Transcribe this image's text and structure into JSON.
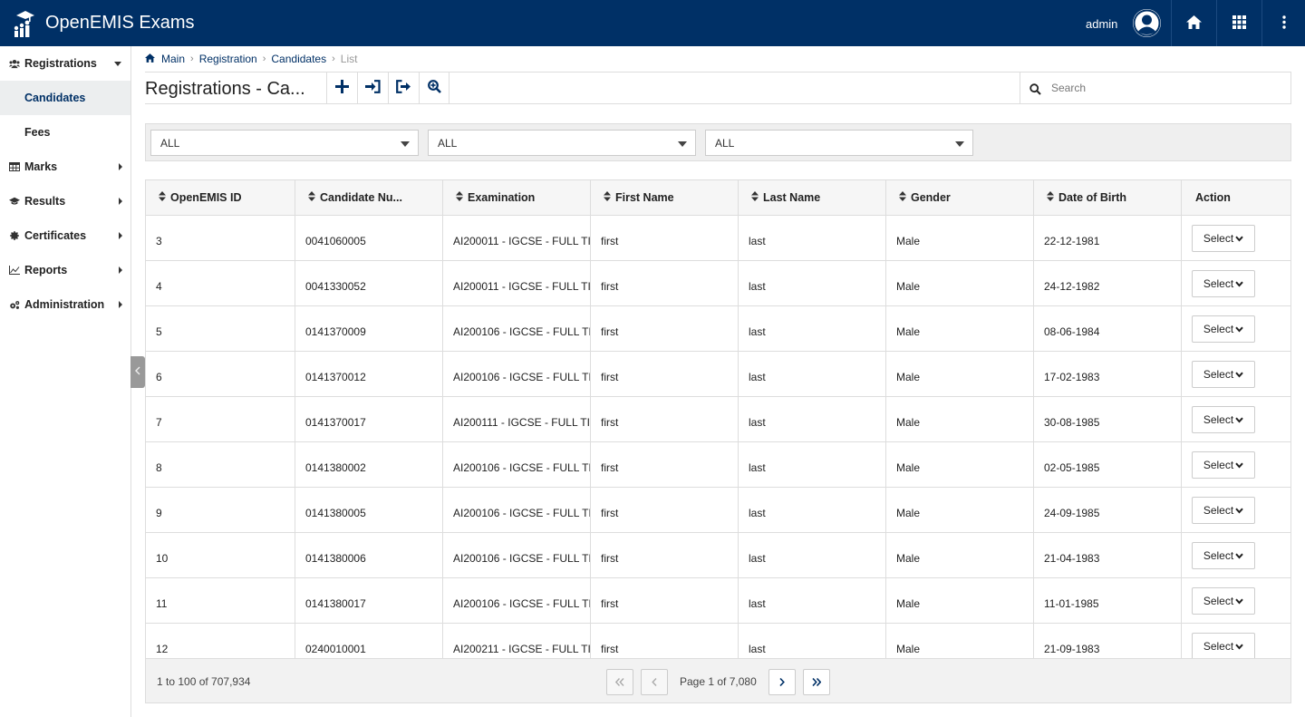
{
  "app": {
    "name": "OpenEMIS Exams",
    "user": "admin"
  },
  "sidebar": {
    "items": [
      {
        "label": "Registrations",
        "expanded": true,
        "icon": "users-icon"
      },
      {
        "label": "Marks",
        "icon": "table-icon"
      },
      {
        "label": "Results",
        "icon": "graduation-cap-icon"
      },
      {
        "label": "Certificates",
        "icon": "certificate-icon"
      },
      {
        "label": "Reports",
        "icon": "line-chart-icon"
      },
      {
        "label": "Administration",
        "icon": "cogs-icon"
      }
    ],
    "sub_items": [
      {
        "label": "Candidates",
        "active": true
      },
      {
        "label": "Fees"
      }
    ]
  },
  "breadcrumb": [
    "Main",
    "Registration",
    "Candidates",
    "List"
  ],
  "page": {
    "title": "Registrations - Ca..."
  },
  "search": {
    "placeholder": "Search"
  },
  "filters": [
    "ALL",
    "ALL",
    "ALL"
  ],
  "table": {
    "columns": [
      "OpenEMIS ID",
      "Candidate Nu...",
      "Examination",
      "First Name",
      "Last Name",
      "Gender",
      "Date of Birth",
      "Action"
    ],
    "rows": [
      [
        "3",
        "0041060005",
        "AI200011 - IGCSE - FULL TI",
        "first",
        "last",
        "Male",
        "22-12-1981"
      ],
      [
        "4",
        "0041330052",
        "AI200011 - IGCSE - FULL TI",
        "first",
        "last",
        "Male",
        "24-12-1982"
      ],
      [
        "5",
        "0141370009",
        "AI200106 - IGCSE - FULL TI",
        "first",
        "last",
        "Male",
        "08-06-1984"
      ],
      [
        "6",
        "0141370012",
        "AI200106 - IGCSE - FULL TI",
        "first",
        "last",
        "Male",
        "17-02-1983"
      ],
      [
        "7",
        "0141370017",
        "AI200111 - IGCSE - FULL TI",
        "first",
        "last",
        "Male",
        "30-08-1985"
      ],
      [
        "8",
        "0141380002",
        "AI200106 - IGCSE - FULL TI",
        "first",
        "last",
        "Male",
        "02-05-1985"
      ],
      [
        "9",
        "0141380005",
        "AI200106 - IGCSE - FULL TI",
        "first",
        "last",
        "Male",
        "24-09-1985"
      ],
      [
        "10",
        "0141380006",
        "AI200106 - IGCSE - FULL TI",
        "first",
        "last",
        "Male",
        "21-04-1983"
      ],
      [
        "11",
        "0141380017",
        "AI200106 - IGCSE - FULL TI",
        "first",
        "last",
        "Male",
        "11-01-1985"
      ],
      [
        "12",
        "0240010001",
        "AI200211 - IGCSE - FULL TI",
        "first",
        "last",
        "Male",
        "21-09-1983"
      ]
    ],
    "action_label": "Select"
  },
  "pagination": {
    "summary": "1 to 100 of 707,934",
    "page_info": "Page 1 of 7,080"
  },
  "colors": {
    "header_bg": "#003066",
    "active_bg": "#eceeef"
  }
}
